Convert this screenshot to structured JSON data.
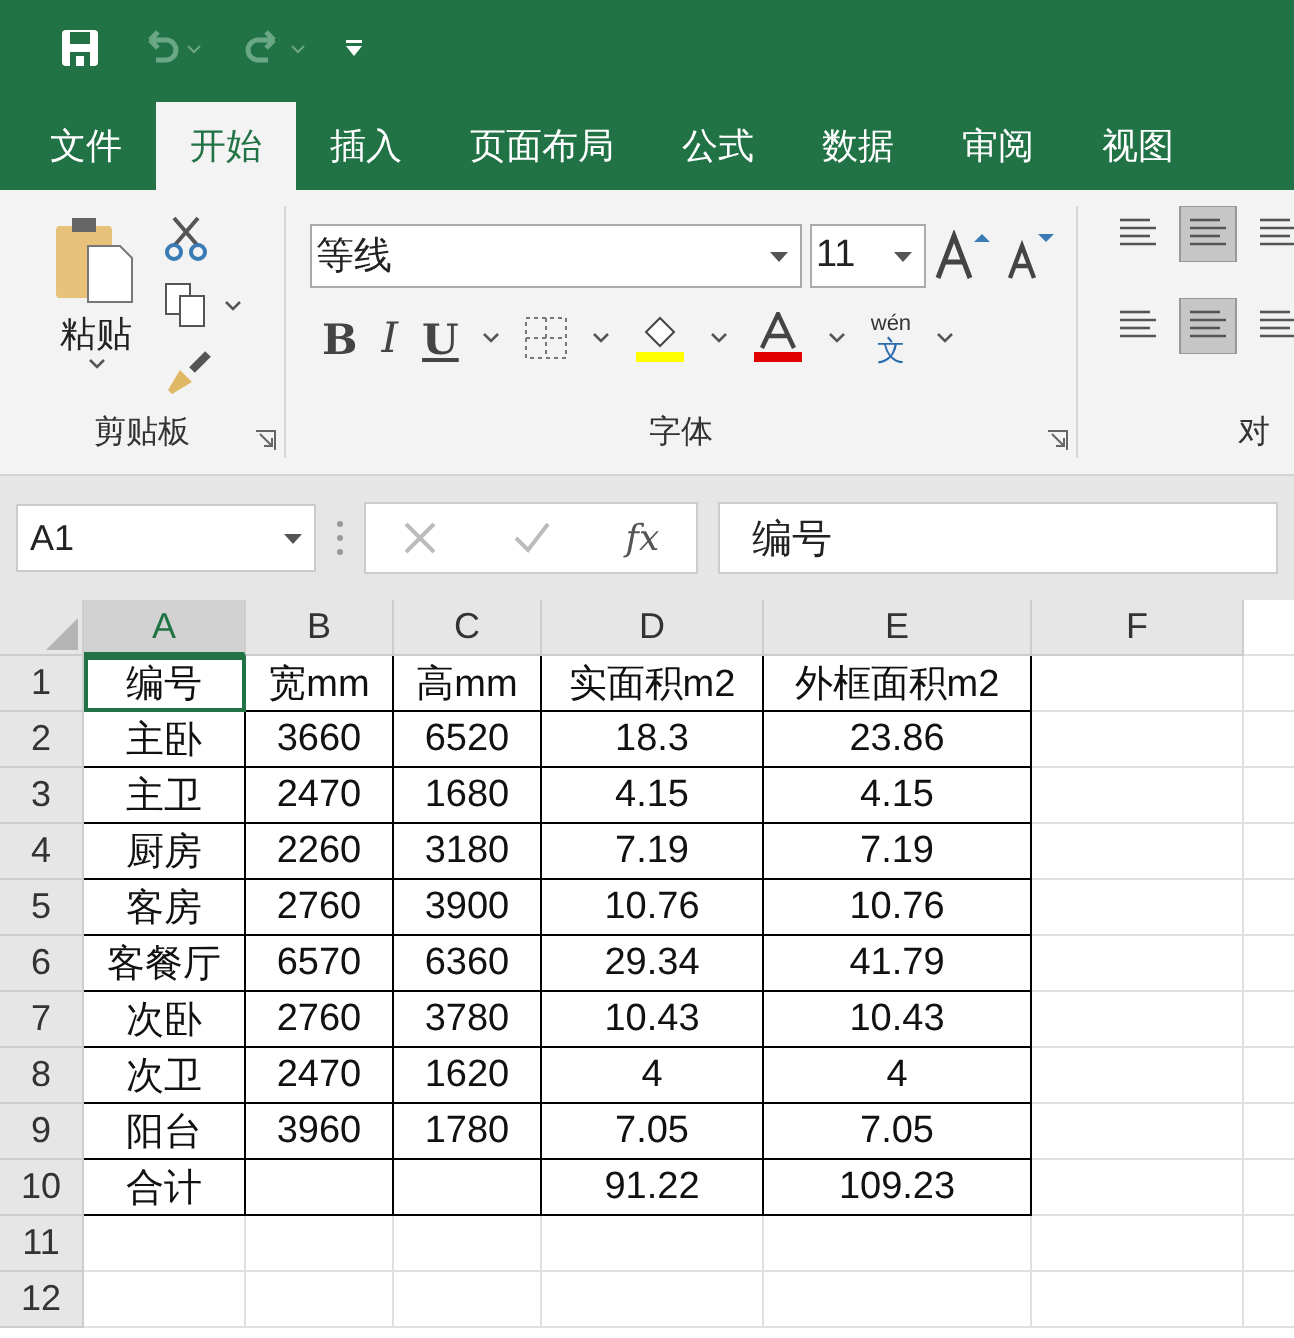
{
  "ribbon_tabs": [
    {
      "label": "文件",
      "selected": false
    },
    {
      "label": "开始",
      "selected": true
    },
    {
      "label": "插入",
      "selected": false
    },
    {
      "label": "页面布局",
      "selected": false
    },
    {
      "label": "公式",
      "selected": false
    },
    {
      "label": "数据",
      "selected": false
    },
    {
      "label": "审阅",
      "selected": false
    },
    {
      "label": "视图",
      "selected": false
    }
  ],
  "clipboard": {
    "paste_label": "粘贴",
    "group_label": "剪贴板"
  },
  "font_group": {
    "font_name": "等线",
    "font_size": "11",
    "group_label": "字体",
    "bold": "B",
    "italic": "I",
    "underline": "U",
    "phonetic_top": "wén",
    "phonetic_bottom": "文"
  },
  "alignment_group": {
    "group_label": "对"
  },
  "name_box": "A1",
  "fx_label": "fx",
  "formula": "编号",
  "columns": [
    {
      "label": "A",
      "selected": true
    },
    {
      "label": "B",
      "selected": false
    },
    {
      "label": "C",
      "selected": false
    },
    {
      "label": "D",
      "selected": false
    },
    {
      "label": "E",
      "selected": false
    },
    {
      "label": "F",
      "selected": false
    }
  ],
  "rows": [
    {
      "number": "1",
      "cells": [
        "编号",
        "宽mm",
        "高mm",
        "实面积m2",
        "外框面积m2"
      ]
    },
    {
      "number": "2",
      "cells": [
        "主卧",
        "3660",
        "6520",
        "18.3",
        "23.86"
      ]
    },
    {
      "number": "3",
      "cells": [
        "主卫",
        "2470",
        "1680",
        "4.15",
        "4.15"
      ]
    },
    {
      "number": "4",
      "cells": [
        "厨房",
        "2260",
        "3180",
        "7.19",
        "7.19"
      ]
    },
    {
      "number": "5",
      "cells": [
        "客房",
        "2760",
        "3900",
        "10.76",
        "10.76"
      ]
    },
    {
      "number": "6",
      "cells": [
        "客餐厅",
        "6570",
        "6360",
        "29.34",
        "41.79"
      ]
    },
    {
      "number": "7",
      "cells": [
        "次卧",
        "2760",
        "3780",
        "10.43",
        "10.43"
      ]
    },
    {
      "number": "8",
      "cells": [
        "次卫",
        "2470",
        "1620",
        "4",
        "4"
      ]
    },
    {
      "number": "9",
      "cells": [
        "阳台",
        "3960",
        "1780",
        "7.05",
        "7.05"
      ]
    },
    {
      "number": "10",
      "cells": [
        "合计",
        "",
        "",
        "91.22",
        "109.23"
      ]
    },
    {
      "number": "11",
      "cells": []
    },
    {
      "number": "12",
      "cells": []
    }
  ]
}
